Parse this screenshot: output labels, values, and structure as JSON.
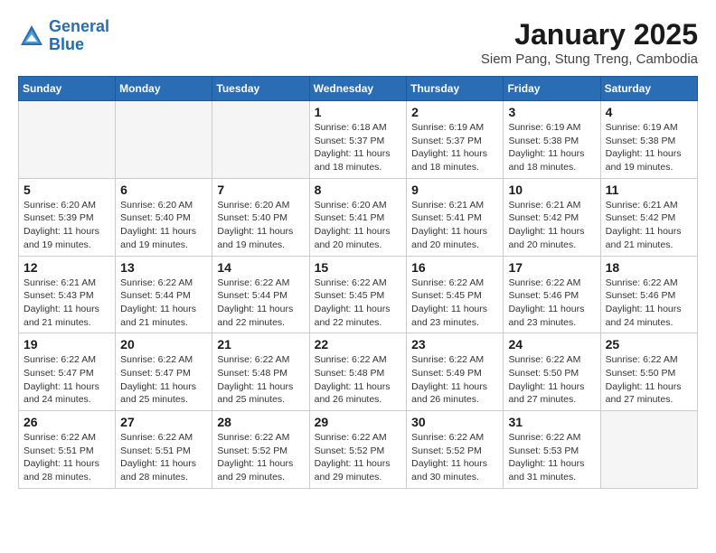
{
  "logo": {
    "line1": "General",
    "line2": "Blue"
  },
  "title": "January 2025",
  "subtitle": "Siem Pang, Stung Treng, Cambodia",
  "days_of_week": [
    "Sunday",
    "Monday",
    "Tuesday",
    "Wednesday",
    "Thursday",
    "Friday",
    "Saturday"
  ],
  "weeks": [
    [
      {
        "day": "",
        "info": ""
      },
      {
        "day": "",
        "info": ""
      },
      {
        "day": "",
        "info": ""
      },
      {
        "day": "1",
        "info": "Sunrise: 6:18 AM\nSunset: 5:37 PM\nDaylight: 11 hours and 18 minutes."
      },
      {
        "day": "2",
        "info": "Sunrise: 6:19 AM\nSunset: 5:37 PM\nDaylight: 11 hours and 18 minutes."
      },
      {
        "day": "3",
        "info": "Sunrise: 6:19 AM\nSunset: 5:38 PM\nDaylight: 11 hours and 18 minutes."
      },
      {
        "day": "4",
        "info": "Sunrise: 6:19 AM\nSunset: 5:38 PM\nDaylight: 11 hours and 19 minutes."
      }
    ],
    [
      {
        "day": "5",
        "info": "Sunrise: 6:20 AM\nSunset: 5:39 PM\nDaylight: 11 hours and 19 minutes."
      },
      {
        "day": "6",
        "info": "Sunrise: 6:20 AM\nSunset: 5:40 PM\nDaylight: 11 hours and 19 minutes."
      },
      {
        "day": "7",
        "info": "Sunrise: 6:20 AM\nSunset: 5:40 PM\nDaylight: 11 hours and 19 minutes."
      },
      {
        "day": "8",
        "info": "Sunrise: 6:20 AM\nSunset: 5:41 PM\nDaylight: 11 hours and 20 minutes."
      },
      {
        "day": "9",
        "info": "Sunrise: 6:21 AM\nSunset: 5:41 PM\nDaylight: 11 hours and 20 minutes."
      },
      {
        "day": "10",
        "info": "Sunrise: 6:21 AM\nSunset: 5:42 PM\nDaylight: 11 hours and 20 minutes."
      },
      {
        "day": "11",
        "info": "Sunrise: 6:21 AM\nSunset: 5:42 PM\nDaylight: 11 hours and 21 minutes."
      }
    ],
    [
      {
        "day": "12",
        "info": "Sunrise: 6:21 AM\nSunset: 5:43 PM\nDaylight: 11 hours and 21 minutes."
      },
      {
        "day": "13",
        "info": "Sunrise: 6:22 AM\nSunset: 5:44 PM\nDaylight: 11 hours and 21 minutes."
      },
      {
        "day": "14",
        "info": "Sunrise: 6:22 AM\nSunset: 5:44 PM\nDaylight: 11 hours and 22 minutes."
      },
      {
        "day": "15",
        "info": "Sunrise: 6:22 AM\nSunset: 5:45 PM\nDaylight: 11 hours and 22 minutes."
      },
      {
        "day": "16",
        "info": "Sunrise: 6:22 AM\nSunset: 5:45 PM\nDaylight: 11 hours and 23 minutes."
      },
      {
        "day": "17",
        "info": "Sunrise: 6:22 AM\nSunset: 5:46 PM\nDaylight: 11 hours and 23 minutes."
      },
      {
        "day": "18",
        "info": "Sunrise: 6:22 AM\nSunset: 5:46 PM\nDaylight: 11 hours and 24 minutes."
      }
    ],
    [
      {
        "day": "19",
        "info": "Sunrise: 6:22 AM\nSunset: 5:47 PM\nDaylight: 11 hours and 24 minutes."
      },
      {
        "day": "20",
        "info": "Sunrise: 6:22 AM\nSunset: 5:47 PM\nDaylight: 11 hours and 25 minutes."
      },
      {
        "day": "21",
        "info": "Sunrise: 6:22 AM\nSunset: 5:48 PM\nDaylight: 11 hours and 25 minutes."
      },
      {
        "day": "22",
        "info": "Sunrise: 6:22 AM\nSunset: 5:48 PM\nDaylight: 11 hours and 26 minutes."
      },
      {
        "day": "23",
        "info": "Sunrise: 6:22 AM\nSunset: 5:49 PM\nDaylight: 11 hours and 26 minutes."
      },
      {
        "day": "24",
        "info": "Sunrise: 6:22 AM\nSunset: 5:50 PM\nDaylight: 11 hours and 27 minutes."
      },
      {
        "day": "25",
        "info": "Sunrise: 6:22 AM\nSunset: 5:50 PM\nDaylight: 11 hours and 27 minutes."
      }
    ],
    [
      {
        "day": "26",
        "info": "Sunrise: 6:22 AM\nSunset: 5:51 PM\nDaylight: 11 hours and 28 minutes."
      },
      {
        "day": "27",
        "info": "Sunrise: 6:22 AM\nSunset: 5:51 PM\nDaylight: 11 hours and 28 minutes."
      },
      {
        "day": "28",
        "info": "Sunrise: 6:22 AM\nSunset: 5:52 PM\nDaylight: 11 hours and 29 minutes."
      },
      {
        "day": "29",
        "info": "Sunrise: 6:22 AM\nSunset: 5:52 PM\nDaylight: 11 hours and 29 minutes."
      },
      {
        "day": "30",
        "info": "Sunrise: 6:22 AM\nSunset: 5:52 PM\nDaylight: 11 hours and 30 minutes."
      },
      {
        "day": "31",
        "info": "Sunrise: 6:22 AM\nSunset: 5:53 PM\nDaylight: 11 hours and 31 minutes."
      },
      {
        "day": "",
        "info": ""
      }
    ]
  ]
}
